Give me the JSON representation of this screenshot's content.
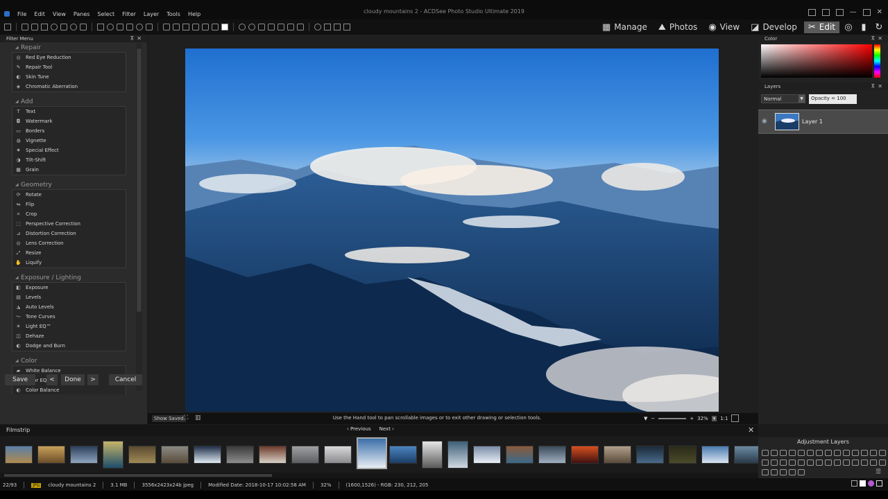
{
  "window": {
    "title": "cloudy mountains 2 - ACDSee Photo Studio Ultimate 2019"
  },
  "menu": [
    "File",
    "Edit",
    "View",
    "Panes",
    "Select",
    "Filter",
    "Layer",
    "Tools",
    "Help"
  ],
  "modes": [
    {
      "label": "Manage",
      "icon": "grid-icon"
    },
    {
      "label": "Photos",
      "icon": "photos-icon"
    },
    {
      "label": "View",
      "icon": "eye-icon"
    },
    {
      "label": "Develop",
      "icon": "develop-icon"
    },
    {
      "label": "Edit",
      "icon": "edit-icon",
      "active": true
    }
  ],
  "left_panel": {
    "title": "Filter Menu",
    "sections": [
      {
        "name": "Repair",
        "items": [
          "Red Eye Reduction",
          "Repair Tool",
          "Skin Tune",
          "Chromatic Aberration"
        ]
      },
      {
        "name": "Add",
        "items": [
          "Text",
          "Watermark",
          "Borders",
          "Vignette",
          "Special Effect",
          "Tilt-Shift",
          "Grain"
        ]
      },
      {
        "name": "Geometry",
        "items": [
          "Rotate",
          "Flip",
          "Crop",
          "Perspective Correction",
          "Distortion Correction",
          "Lens Correction",
          "Resize",
          "Liquify"
        ]
      },
      {
        "name": "Exposure / Lighting",
        "items": [
          "Exposure",
          "Levels",
          "Auto Levels",
          "Tone Curves",
          "Light EQ™",
          "Dehaze",
          "Dodge and Burn"
        ]
      },
      {
        "name": "Color",
        "items": [
          "White Balance",
          "Color EQ",
          "Color Balance"
        ]
      }
    ],
    "buttons": {
      "save": "Save",
      "prev": "<",
      "done": "Done",
      "next": ">",
      "cancel": "Cancel"
    }
  },
  "canvas": {
    "show_saved": "Show Saved",
    "hint": "Use the Hand tool to pan scrollable images or to exit other drawing or selection tools.",
    "zoom": "32%",
    "ratio": "1:1"
  },
  "right_panel": {
    "color_title": "Color",
    "layers_title": "Layers",
    "blend_mode": "Normal",
    "opacity": "Opacity = 100",
    "layer_name": "Layer 1",
    "adjustment_title": "Adjustment Layers"
  },
  "filmstrip": {
    "title": "Filmstrip",
    "previous": "Previous",
    "next": "Next"
  },
  "status": {
    "index": "22/93",
    "format": "JPG",
    "filename": "cloudy mountains 2",
    "filesize": "3.1 MB",
    "dimensions": "3556x2423x24b jpeg",
    "modified": "Modified Date: 2018-10-17 10:02:58 AM",
    "zoom": "32%",
    "pixel": "(1600,1526) - RGB: 230, 212, 205"
  }
}
